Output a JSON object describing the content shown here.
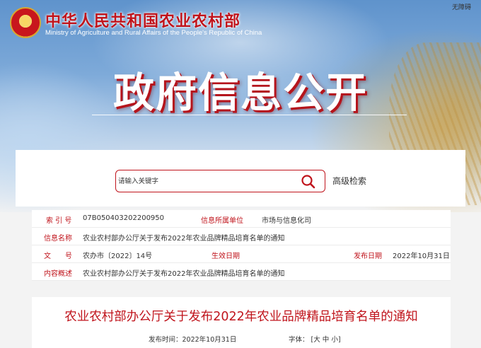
{
  "header": {
    "site_title": "中华人民共和国农业农村部",
    "site_subtitle": "Ministry of Agriculture and Rural Affairs of the People's Republic of China",
    "accessibility_label": "无障碍",
    "hero_title": "政府信息公开",
    "emblem_icon": "national-emblem"
  },
  "search": {
    "placeholder": "请输入关键字",
    "search_icon": "search-icon",
    "advanced_label": "高级检索"
  },
  "info": {
    "index_label": "索 引 号",
    "index_value": "07B050403202200950",
    "category_label": "信息所属单位",
    "category_value": "市场与信息化司",
    "name_label": "信息名称",
    "name_value": "农业农村部办公厅关于发布2022年农业品牌精品培育名单的通知",
    "doc_no_label": "文　　号",
    "doc_no_value": "农办市〔2022〕14号",
    "effective_label": "生效日期",
    "effective_value": "",
    "publish_label": "发布日期",
    "publish_value": "2022年10月31日",
    "summary_label": "内容概述",
    "summary_value": "农业农村部办公厅关于发布2022年农业品牌精品培育名单的通知"
  },
  "document": {
    "title": "农业农村部办公厅关于发布2022年农业品牌精品培育名单的通知",
    "publish_time_label": "发布时间：2022年10月31日",
    "font_label": "字体：",
    "font_options": [
      "[大",
      "中",
      "小]"
    ]
  },
  "colors": {
    "brand_red": "#c0141c",
    "sky_blue": "#7eaad9"
  }
}
